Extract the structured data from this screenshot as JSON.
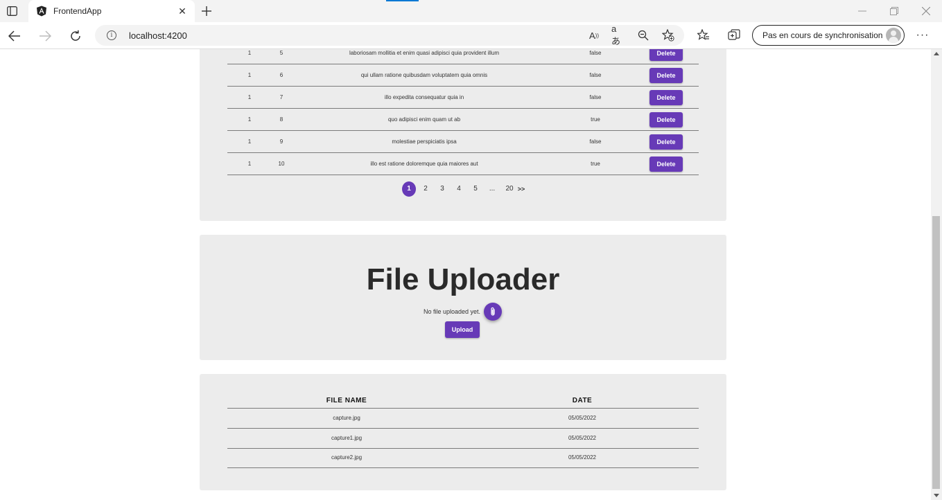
{
  "browser": {
    "tab_title": "FrontendApp",
    "url": "localhost:4200",
    "sync_label": "Pas en cours de synchronisation"
  },
  "todos": {
    "rows": [
      {
        "user_id": "1",
        "id": "5",
        "title": "laboriosam mollitia et enim quasi adipisci quia provident illum",
        "completed": "false",
        "action": "Delete"
      },
      {
        "user_id": "1",
        "id": "6",
        "title": "qui ullam ratione quibusdam voluptatem quia omnis",
        "completed": "false",
        "action": "Delete"
      },
      {
        "user_id": "1",
        "id": "7",
        "title": "illo expedita consequatur quia in",
        "completed": "false",
        "action": "Delete"
      },
      {
        "user_id": "1",
        "id": "8",
        "title": "quo adipisci enim quam ut ab",
        "completed": "true",
        "action": "Delete"
      },
      {
        "user_id": "1",
        "id": "9",
        "title": "molestiae perspiciatis ipsa",
        "completed": "false",
        "action": "Delete"
      },
      {
        "user_id": "1",
        "id": "10",
        "title": "illo est ratione doloremque quia maiores aut",
        "completed": "true",
        "action": "Delete"
      }
    ],
    "pagination": {
      "pages": [
        "1",
        "2",
        "3",
        "4",
        "5"
      ],
      "ellipsis": "...",
      "last": "20",
      "next": ">>",
      "current": "1"
    }
  },
  "uploader": {
    "title": "File Uploader",
    "status": "No file uploaded yet.",
    "upload_label": "Upload"
  },
  "files": {
    "headers": [
      "FILE NAME",
      "DATE"
    ],
    "rows": [
      {
        "name": "capture.jpg",
        "date": "05/05/2022"
      },
      {
        "name": "capture1.jpg",
        "date": "05/05/2022"
      },
      {
        "name": "capture2.jpg",
        "date": "05/05/2022"
      }
    ]
  },
  "colors": {
    "accent": "#673ab7",
    "card": "#ececec",
    "browser_accent": "#0078d4"
  },
  "icons": {
    "tabs": "tab-panel-icon",
    "favicon": "angular-logo-icon",
    "attach": "paperclip-icon"
  }
}
